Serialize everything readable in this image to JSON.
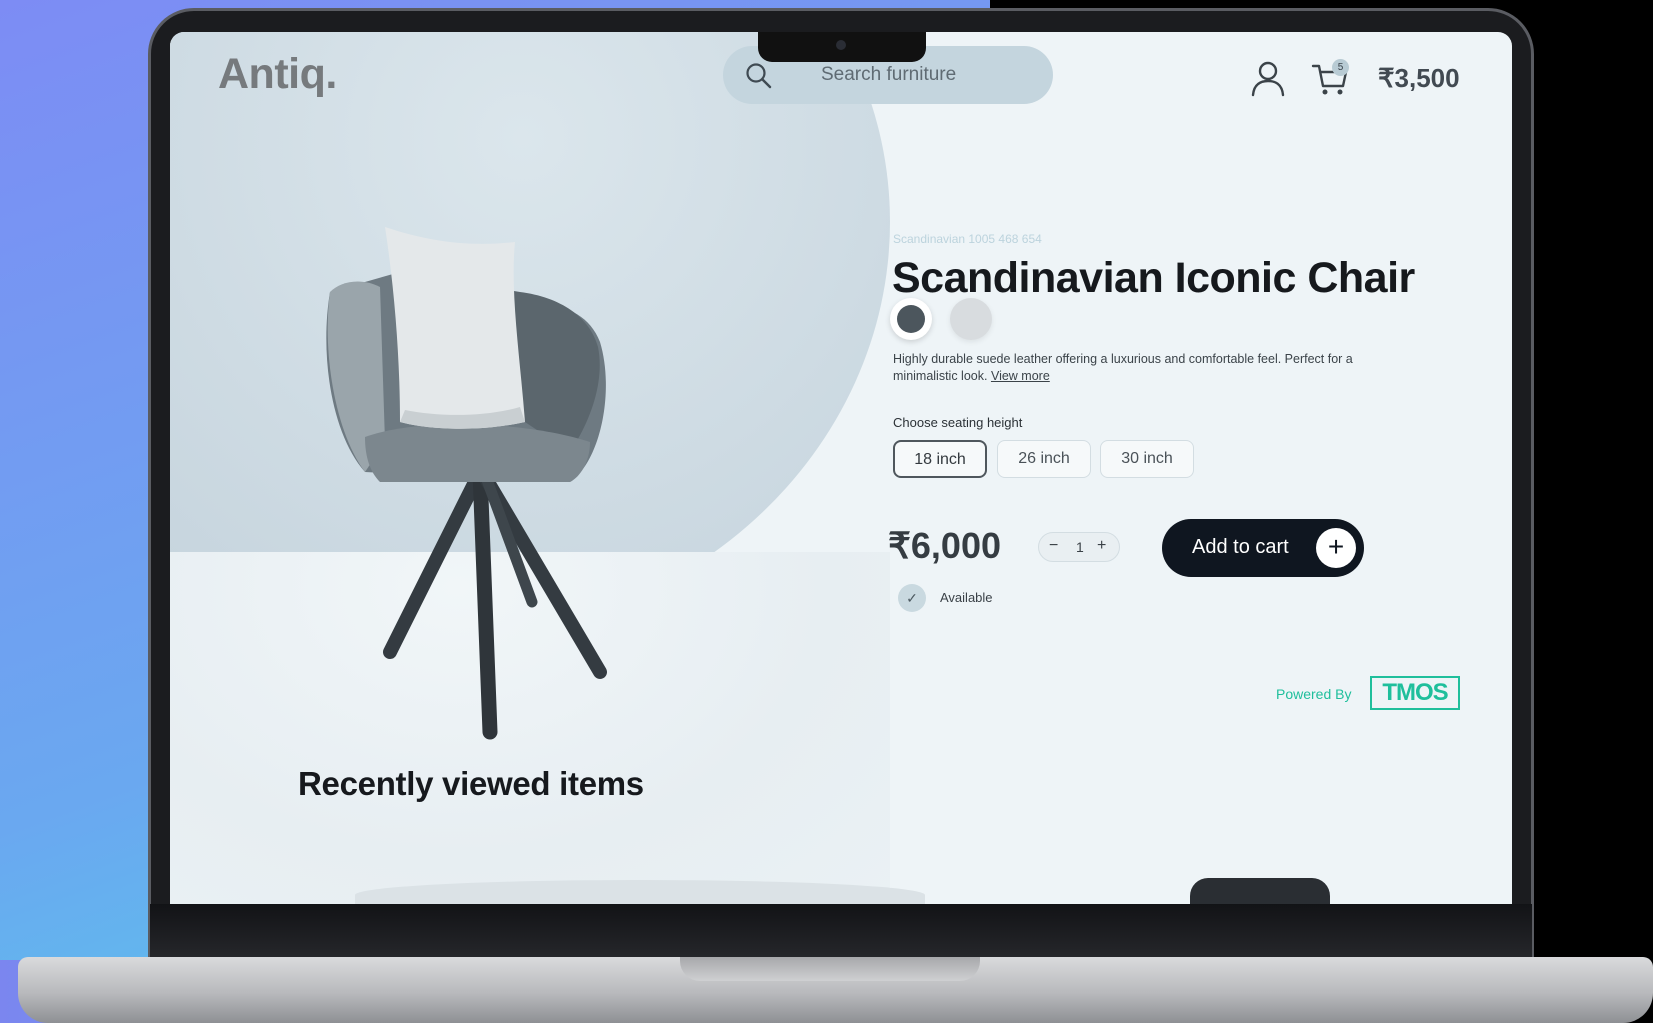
{
  "header": {
    "logo": "Antiq.",
    "search_placeholder": "Search furniture",
    "cart_count": "5",
    "cart_total": "₹3,500"
  },
  "product": {
    "sku": "Scandinavian 1005 468 654",
    "title": "Scandinavian Iconic Chair",
    "colors": [
      "#4c565d",
      "#d8dcdf"
    ],
    "description": "Highly durable suede leather offering a luxurious and comfortable feel. Perfect for a minimalistic look.",
    "view_more": "View more",
    "seating_label": "Choose seating height",
    "seating_options": [
      "18 inch",
      "26 inch",
      "30 inch"
    ],
    "selected_option": "18 inch",
    "price": "₹6,000",
    "quantity": "1",
    "minus": "−",
    "plus": "+",
    "add_to_cart": "Add to cart",
    "availability": "Available"
  },
  "footer": {
    "powered_by": "Powered By",
    "brand": "TMOS"
  },
  "sections": {
    "recent_title": "Recently viewed items"
  },
  "colors": {
    "accent_dark": "#0f1620",
    "brand_green": "#1fbf9c",
    "hero_bg": "#c8d6df"
  }
}
